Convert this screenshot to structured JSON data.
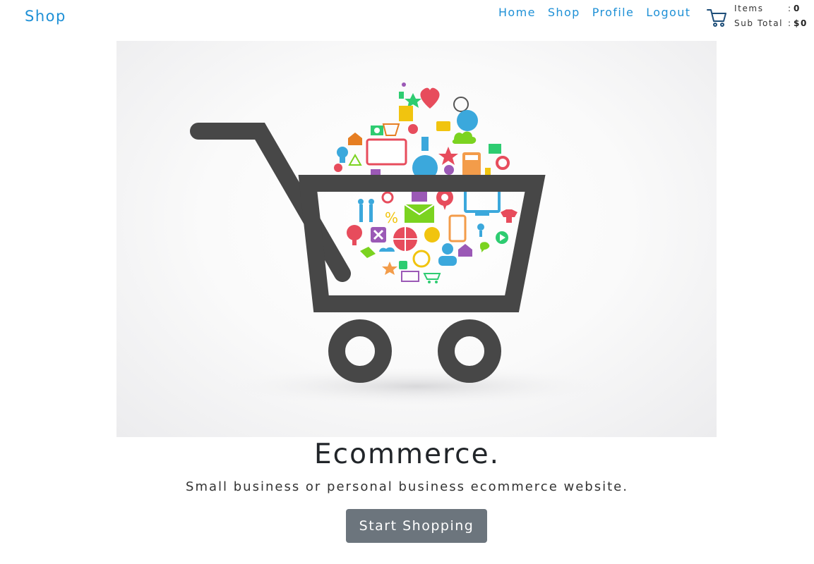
{
  "brand": "Shop",
  "nav": {
    "home": "Home",
    "shop": "Shop",
    "profile": "Profile",
    "logout": "Logout"
  },
  "cart": {
    "items_label": "Items",
    "items_sep": ":",
    "items_value": "0",
    "subtotal_label": "Sub Total",
    "subtotal_sep": ":",
    "subtotal_value": "$0"
  },
  "hero": {
    "title": "Ecommerce.",
    "subtitle": "Small business or personal business ecommerce website.",
    "button": "Start Shopping"
  },
  "colors": {
    "link": "#1e90d6",
    "button": "#6c757d",
    "cart_dark": "#474747"
  },
  "icons": [
    "shopping-cart-icon",
    "heart-icon",
    "globe-icon",
    "calculator-icon",
    "envelope-icon",
    "location-pin-icon",
    "monitor-icon",
    "star-icon",
    "home-icon",
    "cloud-icon",
    "tshirt-icon",
    "gear-icon",
    "person-icon",
    "camera-icon"
  ]
}
